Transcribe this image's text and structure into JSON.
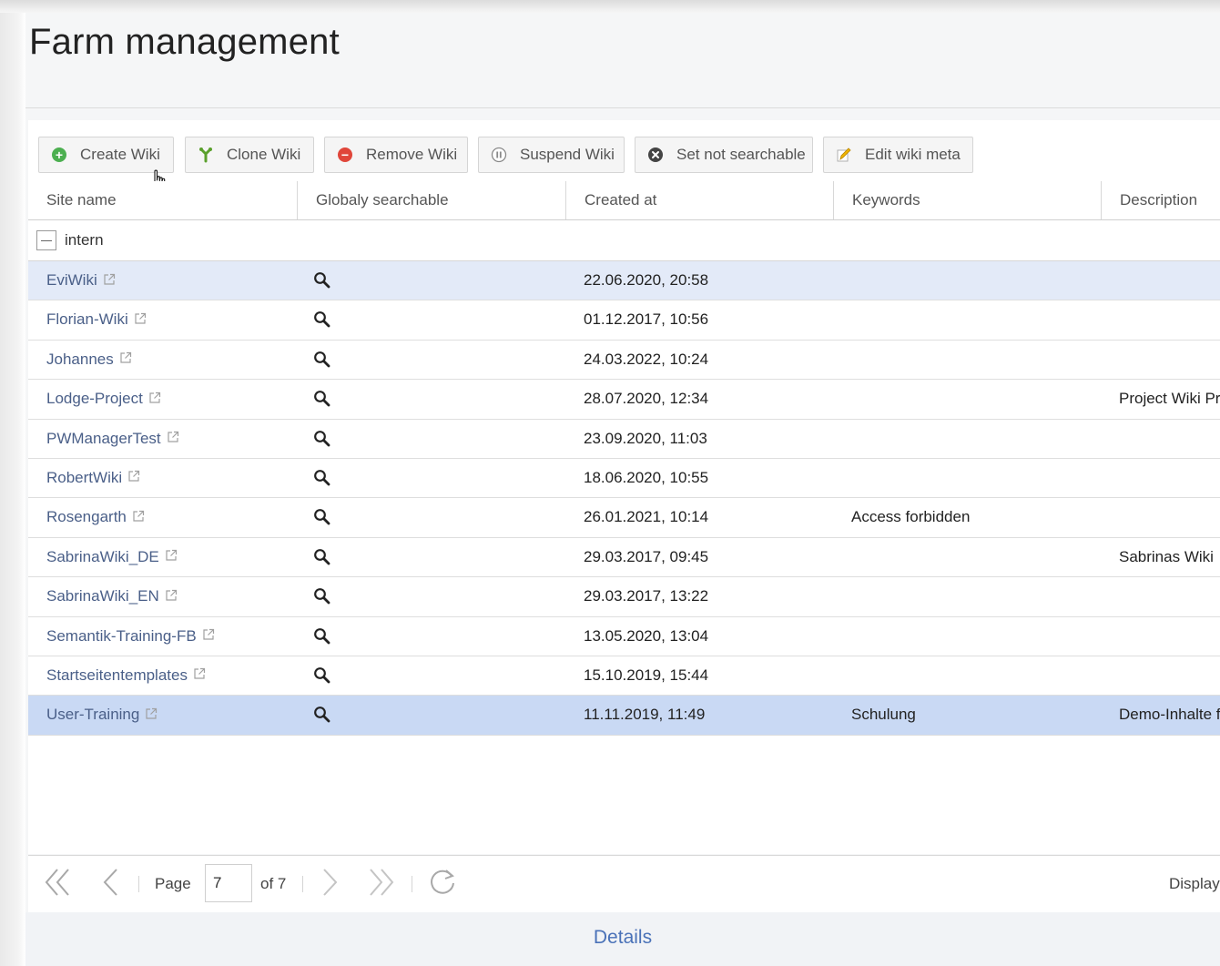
{
  "page": {
    "title": "Farm management"
  },
  "toolbar": {
    "buttons": [
      {
        "label": "Create Wiki",
        "icon": "plus-circle-icon",
        "color": "#4caf50"
      },
      {
        "label": "Clone Wiki",
        "icon": "clone-icon",
        "color": "#5aa02c"
      },
      {
        "label": "Remove Wiki",
        "icon": "minus-circle-icon",
        "color": "#e0463a"
      },
      {
        "label": "Suspend Wiki",
        "icon": "pause-circle-icon",
        "color": "#8a8a8a"
      },
      {
        "label": "Set not searchable",
        "icon": "x-circle-icon",
        "color": "#444444"
      },
      {
        "label": "Edit wiki meta",
        "icon": "pencil-icon",
        "color": "#f0b400"
      }
    ]
  },
  "table": {
    "columns": [
      "Site name",
      "Globaly searchable",
      "Created at",
      "Keywords",
      "Description"
    ],
    "group": {
      "label": "intern"
    },
    "rows": [
      {
        "name": "EviWiki",
        "date": "22.06.2020, 20:58",
        "keywords": "",
        "description": ""
      },
      {
        "name": "Florian-Wiki",
        "date": "01.12.2017, 10:56",
        "keywords": "",
        "description": ""
      },
      {
        "name": "Johannes",
        "date": "24.03.2022, 10:24",
        "keywords": "",
        "description": ""
      },
      {
        "name": "Lodge-Project",
        "date": "28.07.2020, 12:34",
        "keywords": "",
        "description": "Project Wiki Pr"
      },
      {
        "name": "PWManagerTest",
        "date": "23.09.2020, 11:03",
        "keywords": "",
        "description": ""
      },
      {
        "name": "RobertWiki",
        "date": "18.06.2020, 10:55",
        "keywords": "",
        "description": ""
      },
      {
        "name": "Rosengarth",
        "date": "26.01.2021, 10:14",
        "keywords": "Access forbidden",
        "description": ""
      },
      {
        "name": "SabrinaWiki_DE",
        "date": "29.03.2017, 09:45",
        "keywords": "",
        "description": "Sabrinas Wiki"
      },
      {
        "name": "SabrinaWiki_EN",
        "date": "29.03.2017, 13:22",
        "keywords": "",
        "description": ""
      },
      {
        "name": "Semantik-Training-FB",
        "date": "13.05.2020, 13:04",
        "keywords": "",
        "description": ""
      },
      {
        "name": "Startseitentemplates",
        "date": "15.10.2019, 15:44",
        "keywords": "",
        "description": ""
      },
      {
        "name": "User-Training",
        "date": "11.11.2019, 11:49",
        "keywords": "Schulung",
        "description": "Demo-Inhalte f"
      }
    ]
  },
  "pager": {
    "page_label": "Page",
    "current_page": "7",
    "of_label": "of 7",
    "display_label": "Display"
  },
  "footer": {
    "details_label": "Details"
  }
}
